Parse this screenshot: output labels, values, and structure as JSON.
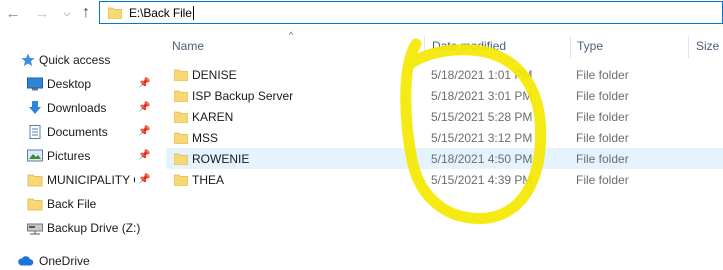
{
  "address_bar": {
    "path": "E:\\Back File"
  },
  "nav_icons": {
    "back": "arrow-left-icon",
    "forward": "arrow-right-icon",
    "recent": "chevron-down-icon",
    "up": "arrow-up-icon"
  },
  "navigation_pane": {
    "items": [
      {
        "label": "Quick access",
        "icon": "star-icon",
        "pinned": false
      },
      {
        "label": "Desktop",
        "icon": "desktop-icon",
        "pinned": true
      },
      {
        "label": "Downloads",
        "icon": "download-icon",
        "pinned": true
      },
      {
        "label": "Documents",
        "icon": "documents-icon",
        "pinned": true
      },
      {
        "label": "Pictures",
        "icon": "pictures-icon",
        "pinned": true
      },
      {
        "label": "MUNICIPALITY O",
        "icon": "folder-icon",
        "pinned": true
      },
      {
        "label": "Back File",
        "icon": "folder-icon",
        "pinned": false
      },
      {
        "label": "Backup Drive (Z:)",
        "icon": "network-drive-icon",
        "pinned": false
      },
      {
        "label": "OneDrive",
        "icon": "cloud-icon",
        "pinned": false
      }
    ]
  },
  "columns": {
    "name": "Name",
    "date_modified": "Date modified",
    "type": "Type",
    "size": "Size"
  },
  "files": [
    {
      "name": "DENISE",
      "date": "5/18/2021 1:01 PM",
      "type": "File folder"
    },
    {
      "name": "ISP Backup Server",
      "date": "5/18/2021 3:01 PM",
      "type": "File folder"
    },
    {
      "name": "KAREN",
      "date": "5/15/2021 5:28 PM",
      "type": "File folder"
    },
    {
      "name": "MSS",
      "date": "5/15/2021 3:12 PM",
      "type": "File folder"
    },
    {
      "name": "ROWENIE",
      "date": "5/18/2021 4:50 PM",
      "type": "File folder",
      "selected": true
    },
    {
      "name": "THEA",
      "date": "5/15/2021 4:39 PM",
      "type": "File folder"
    }
  ],
  "colors": {
    "accent": "#0078d7",
    "folder": "#f8d775",
    "selection": "#e5f3ff",
    "highlighter": "#f5e800"
  }
}
